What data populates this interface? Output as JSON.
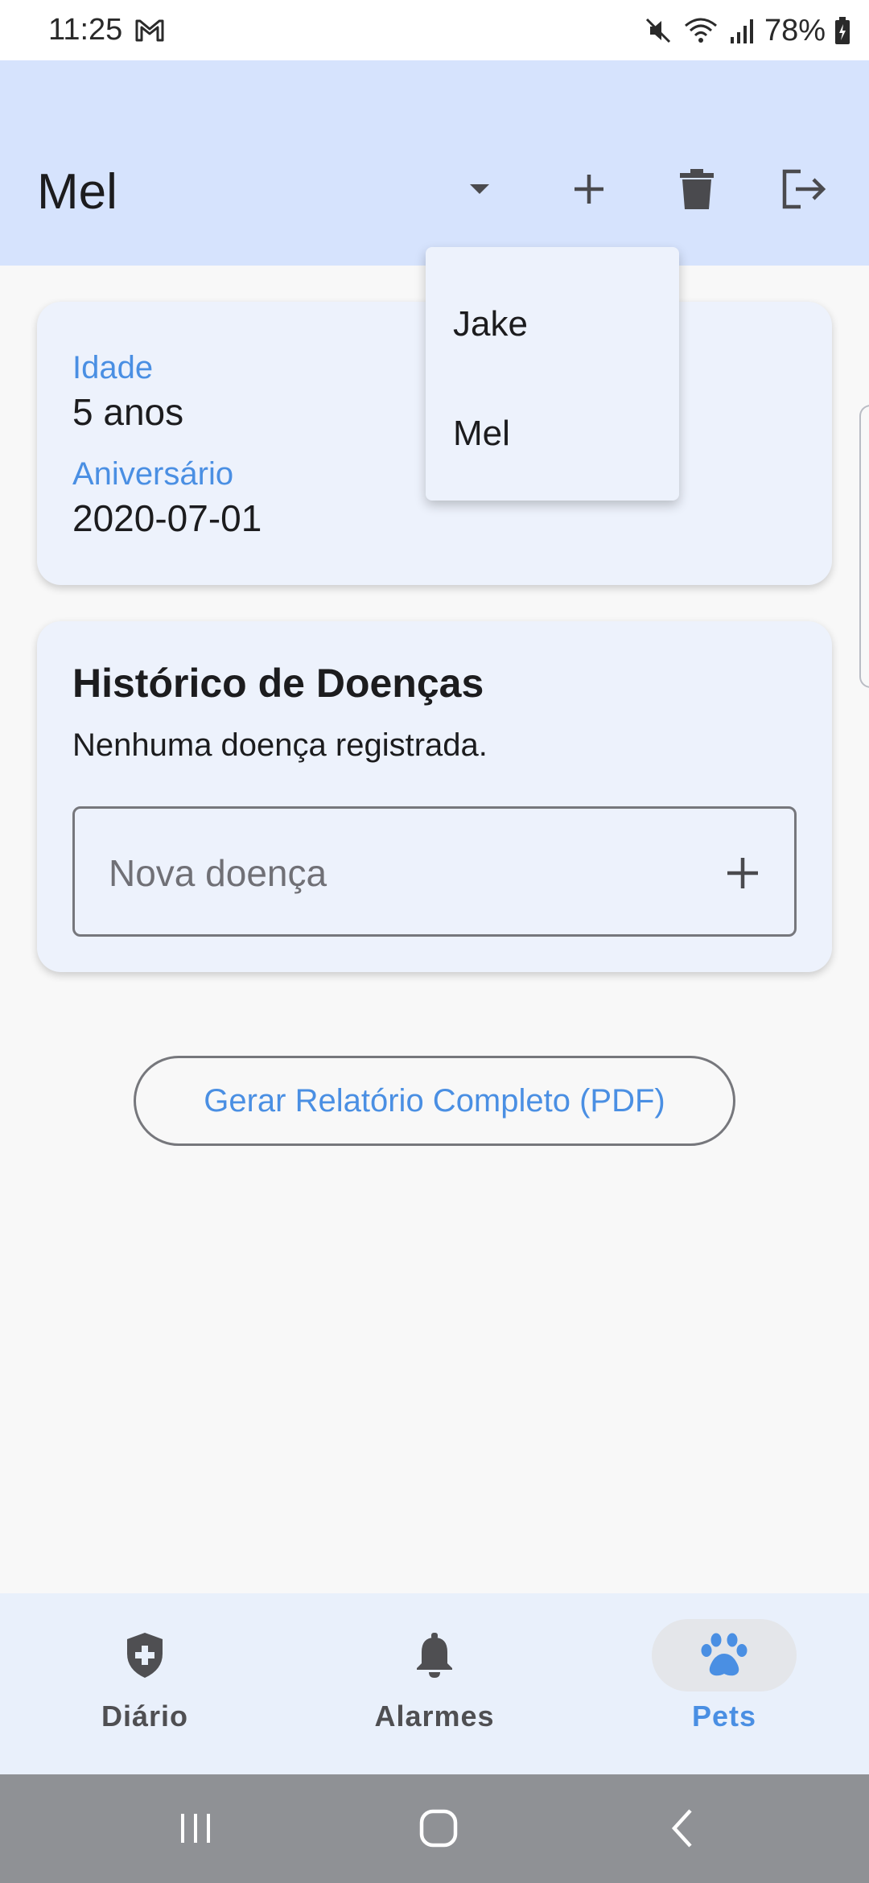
{
  "status_bar": {
    "time": "11:25",
    "battery": "78%",
    "icons": [
      "gmail-icon",
      "mute-icon",
      "wifi-icon",
      "signal-icon",
      "battery-icon"
    ]
  },
  "app_bar": {
    "title": "Mel",
    "actions": [
      "dropdown-arrow-icon",
      "add-icon",
      "delete-icon",
      "logout-icon"
    ]
  },
  "dropdown": {
    "items": [
      {
        "label": "Jake"
      },
      {
        "label": "Mel"
      }
    ]
  },
  "info_card": {
    "age_label": "Idade",
    "age_value": "5 anos",
    "birthday_label": "Aniversário",
    "birthday_value": "2020-07-01"
  },
  "history_card": {
    "title": "Histórico de Doenças",
    "empty_text": "Nenhuma doença registrada.",
    "new_disease_placeholder": "Nova doença",
    "new_disease_value": ""
  },
  "pdf_button": {
    "label": "Gerar Relatório Completo (PDF)"
  },
  "bottom_nav": {
    "items": [
      {
        "label": "Diário",
        "icon": "shield-plus-icon",
        "active": false
      },
      {
        "label": "Alarmes",
        "icon": "bell-icon",
        "active": false
      },
      {
        "label": "Pets",
        "icon": "paw-icon",
        "active": true
      }
    ]
  },
  "colors": {
    "accent": "#4a8fe3",
    "app_bar_bg": "#d6e3fd",
    "card_bg": "#edf2fc"
  }
}
